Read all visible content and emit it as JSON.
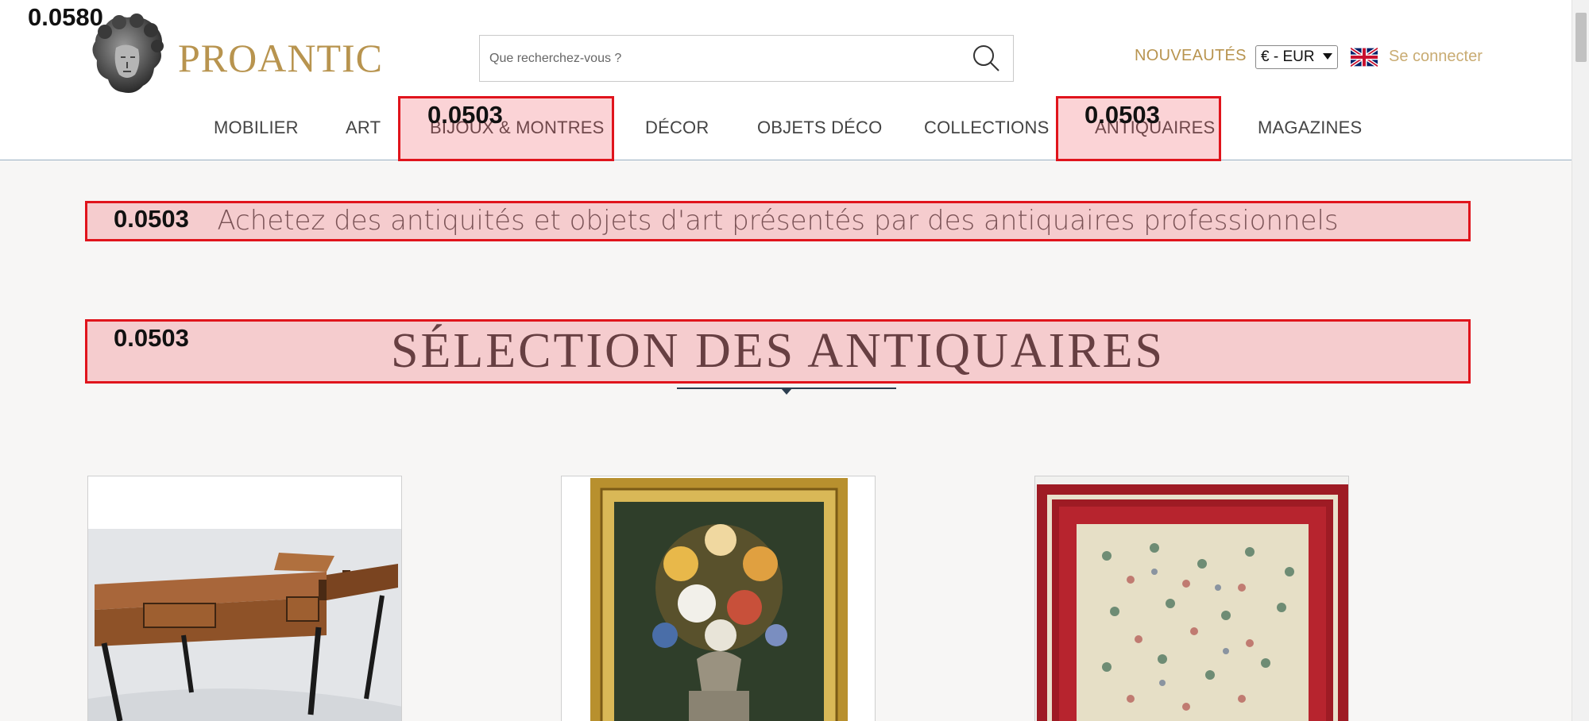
{
  "header": {
    "logo_text": "PROANTIC",
    "search_placeholder": "Que recherchez-vous ?",
    "new_label": "NOUVEAUTÉS",
    "currency": "€ - EUR",
    "login_label": "Se connecter"
  },
  "nav": {
    "items": [
      "MOBILIER",
      "ART",
      "BIJOUX & MONTRES",
      "DÉCOR",
      "OBJETS DÉCO",
      "COLLECTIONS",
      "ANTIQUAIRES",
      "MAGAZINES"
    ]
  },
  "main": {
    "tagline": "Achetez des antiquités et objets d'art présentés par des antiquaires professionnels",
    "section_title": "SÉLECTION DES ANTIQUAIRES"
  },
  "annotations": {
    "top_left_score": "0.0580",
    "score": "0.0503"
  },
  "colors": {
    "brand_gold": "#b8944f",
    "annotation_red": "#e0141c"
  }
}
